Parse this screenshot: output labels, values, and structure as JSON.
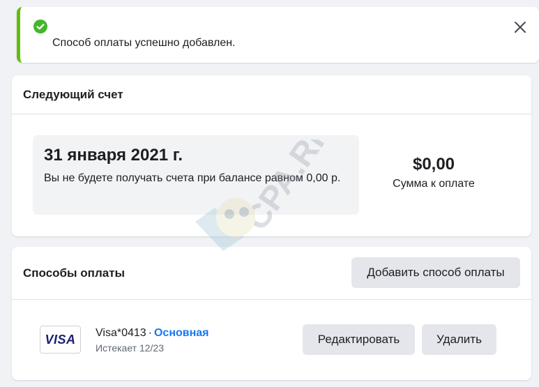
{
  "toast": {
    "message": "Способ оплаты успешно добавлен.",
    "icon": "check-circle-icon",
    "close_icon": "close-icon",
    "accent_color": "#63be09"
  },
  "next_bill": {
    "title": "Следующий счет",
    "date": "31 января 2021 г.",
    "note": "Вы не будете получать счета при балансе равном 0,00 р.",
    "amount": "$0,00",
    "amount_label": "Сумма к оплате"
  },
  "payment_methods": {
    "title": "Способы оплаты",
    "add_button_label": "Добавить способ оплаты",
    "methods": [
      {
        "brand_logo": "VISA",
        "name": "Visa*0413",
        "separator": "·",
        "primary_label": "Основная",
        "expires": "Истекает 12/23",
        "edit_label": "Редактировать",
        "delete_label": "Удалить"
      }
    ]
  },
  "watermark": {
    "text": "CPA.RIP"
  },
  "colors": {
    "background": "#f0f2f5",
    "link_blue": "#1877f2",
    "success_green": "#42b72a",
    "button_gray": "#e4e6eb"
  }
}
